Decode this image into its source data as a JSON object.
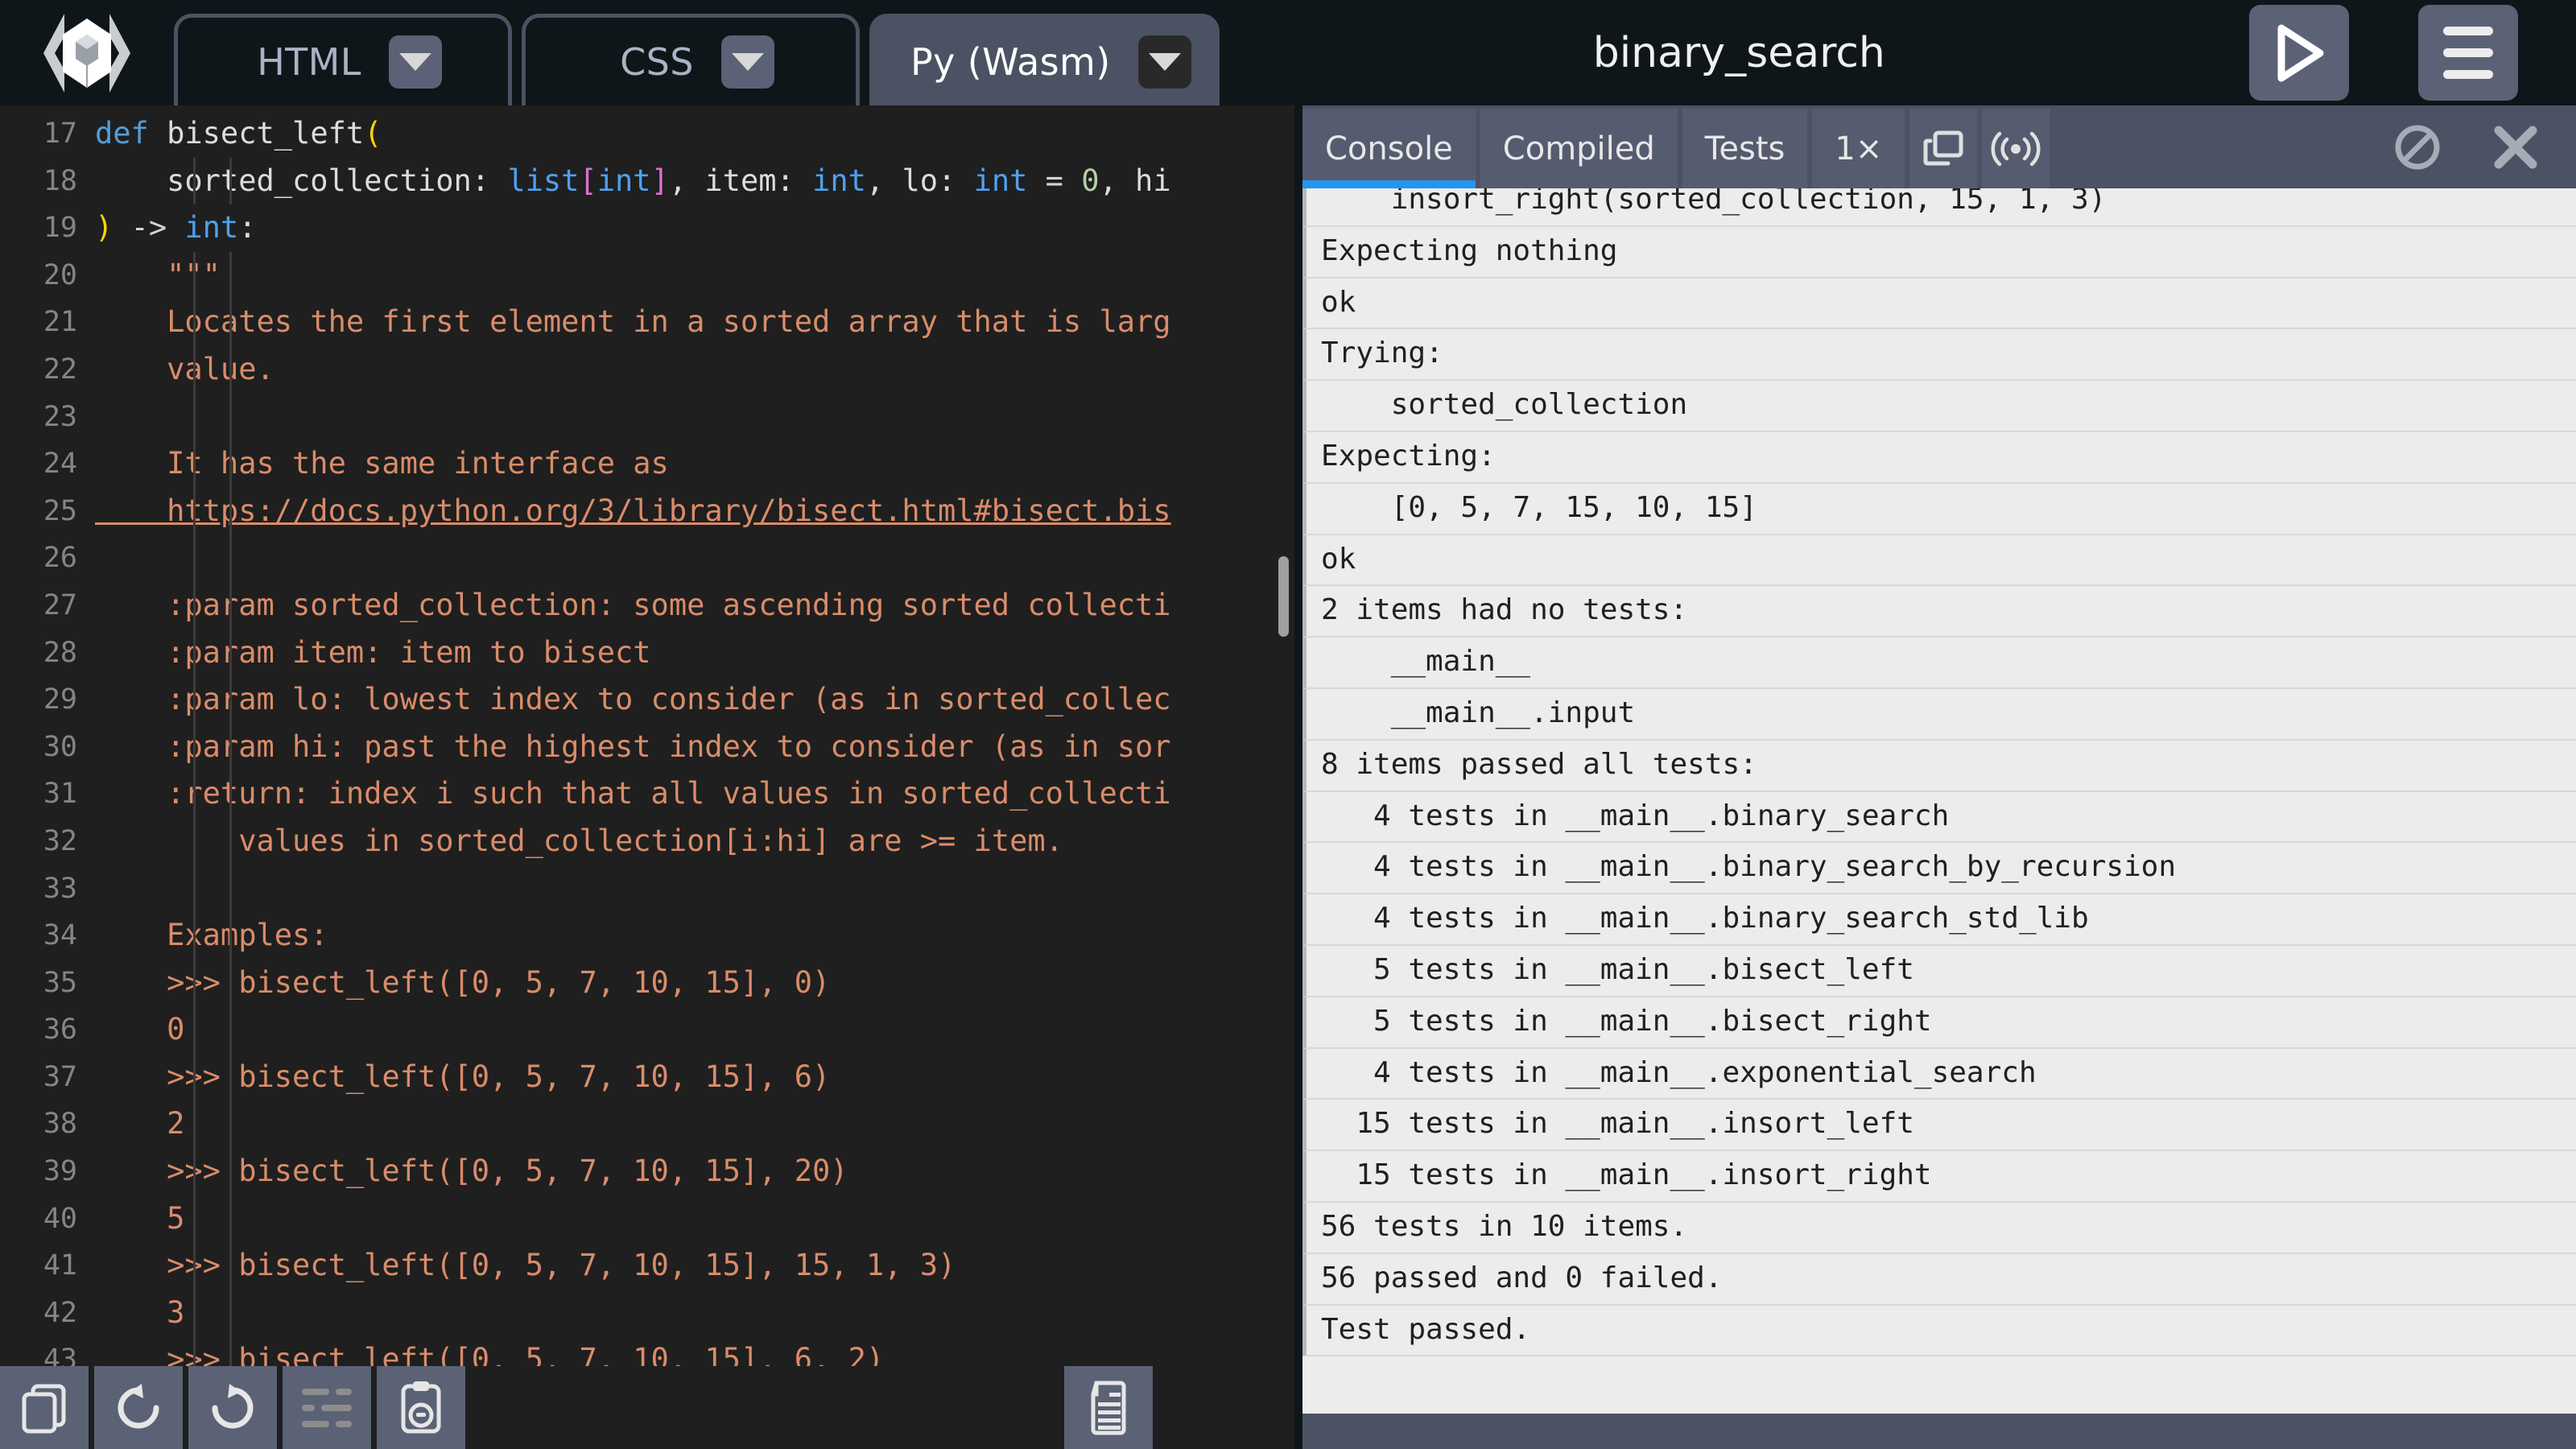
{
  "app": {
    "logo_icon": "code-cube-logo-icon",
    "document_title": "binary_search",
    "run_icon": "play-icon",
    "menu_icon": "hamburger-menu-icon"
  },
  "editor_tabs": [
    {
      "label": "HTML",
      "active": false,
      "caret_icon": "chevron-down-icon"
    },
    {
      "label": "CSS",
      "active": false,
      "caret_icon": "chevron-down-icon"
    },
    {
      "label": "Py (Wasm)",
      "active": true,
      "caret_icon": "chevron-down-icon"
    }
  ],
  "editor": {
    "first_line_number": 17,
    "lines": [
      {
        "n": 17,
        "indent": 0,
        "parts": [
          {
            "t": "def ",
            "c": "k"
          },
          {
            "t": "bisect_left",
            "c": "fn"
          },
          {
            "t": "(",
            "c": "par"
          }
        ]
      },
      {
        "n": 18,
        "indent": 2,
        "parts": [
          {
            "t": "    sorted_collection: ",
            "c": "fn"
          },
          {
            "t": "list",
            "c": "typ"
          },
          {
            "t": "[",
            "c": "brk"
          },
          {
            "t": "int",
            "c": "typ"
          },
          {
            "t": "]",
            "c": "brk"
          },
          {
            "t": ", item: ",
            "c": "fn"
          },
          {
            "t": "int",
            "c": "typ"
          },
          {
            "t": ", lo: ",
            "c": "fn"
          },
          {
            "t": "int",
            "c": "typ"
          },
          {
            "t": " = ",
            "c": "op"
          },
          {
            "t": "0",
            "c": "num"
          },
          {
            "t": ", hi",
            "c": "fn"
          }
        ]
      },
      {
        "n": 19,
        "indent": 0,
        "parts": [
          {
            "t": ")",
            "c": "par"
          },
          {
            "t": " -> ",
            "c": "op"
          },
          {
            "t": "int",
            "c": "typ"
          },
          {
            "t": ":",
            "c": "fn"
          }
        ]
      },
      {
        "n": 20,
        "indent": 2,
        "parts": [
          {
            "t": "    \"\"\"",
            "c": "str"
          }
        ]
      },
      {
        "n": 21,
        "indent": 2,
        "parts": [
          {
            "t": "    Locates the first element in a sorted array that is larg",
            "c": "str"
          }
        ]
      },
      {
        "n": 22,
        "indent": 2,
        "parts": [
          {
            "t": "    value.",
            "c": "str"
          }
        ]
      },
      {
        "n": 23,
        "indent": 2,
        "parts": []
      },
      {
        "n": 24,
        "indent": 2,
        "parts": [
          {
            "t": "    It has the same interface as",
            "c": "str"
          }
        ]
      },
      {
        "n": 25,
        "indent": 2,
        "parts": [
          {
            "t": "    https://docs.python.org/3/library/bisect.html#bisect.bis",
            "c": "lnk"
          }
        ]
      },
      {
        "n": 26,
        "indent": 2,
        "parts": []
      },
      {
        "n": 27,
        "indent": 2,
        "parts": [
          {
            "t": "    :param sorted_collection: some ascending sorted collecti",
            "c": "str"
          }
        ]
      },
      {
        "n": 28,
        "indent": 2,
        "parts": [
          {
            "t": "    :param item: item to bisect",
            "c": "str"
          }
        ]
      },
      {
        "n": 29,
        "indent": 2,
        "parts": [
          {
            "t": "    :param lo: lowest index to consider (as in sorted_collec",
            "c": "str"
          }
        ]
      },
      {
        "n": 30,
        "indent": 2,
        "parts": [
          {
            "t": "    :param hi: past the highest index to consider (as in sor",
            "c": "str"
          }
        ]
      },
      {
        "n": 31,
        "indent": 2,
        "parts": [
          {
            "t": "    :return: index i such that all values in sorted_collecti",
            "c": "str"
          }
        ]
      },
      {
        "n": 32,
        "indent": 3,
        "parts": [
          {
            "t": "        values in sorted_collection[i:hi] are >= item.",
            "c": "str"
          }
        ]
      },
      {
        "n": 33,
        "indent": 2,
        "parts": []
      },
      {
        "n": 34,
        "indent": 2,
        "parts": [
          {
            "t": "    Examples:",
            "c": "str"
          }
        ]
      },
      {
        "n": 35,
        "indent": 2,
        "parts": [
          {
            "t": "    >>> bisect_left([0, 5, 7, 10, 15], 0)",
            "c": "str"
          }
        ]
      },
      {
        "n": 36,
        "indent": 2,
        "parts": [
          {
            "t": "    0",
            "c": "str"
          }
        ]
      },
      {
        "n": 37,
        "indent": 2,
        "parts": [
          {
            "t": "    >>> bisect_left([0, 5, 7, 10, 15], 6)",
            "c": "str"
          }
        ]
      },
      {
        "n": 38,
        "indent": 2,
        "parts": [
          {
            "t": "    2",
            "c": "str"
          }
        ]
      },
      {
        "n": 39,
        "indent": 2,
        "parts": [
          {
            "t": "    >>> bisect_left([0, 5, 7, 10, 15], 20)",
            "c": "str"
          }
        ]
      },
      {
        "n": 40,
        "indent": 2,
        "parts": [
          {
            "t": "    5",
            "c": "str"
          }
        ]
      },
      {
        "n": 41,
        "indent": 2,
        "parts": [
          {
            "t": "    >>> bisect_left([0, 5, 7, 10, 15], 15, 1, 3)",
            "c": "str"
          }
        ]
      },
      {
        "n": 42,
        "indent": 2,
        "parts": [
          {
            "t": "    3",
            "c": "str"
          }
        ]
      },
      {
        "n": 43,
        "indent": 2,
        "parts": [
          {
            "t": "    >>> bisect_left([0, 5, 7, 10, 15], 6, 2)",
            "c": "str"
          }
        ]
      }
    ]
  },
  "editor_toolbar": {
    "buttons": [
      {
        "icon": "duplicate-icon"
      },
      {
        "icon": "undo-icon"
      },
      {
        "icon": "redo-icon"
      },
      {
        "icon": "format-lines-icon"
      },
      {
        "icon": "paste-link-icon"
      }
    ],
    "right_button": {
      "icon": "document-icon"
    }
  },
  "console": {
    "tabs": [
      {
        "label": "Console",
        "active": true
      },
      {
        "label": "Compiled",
        "active": false
      },
      {
        "label": "Tests",
        "active": false
      },
      {
        "label": "1×",
        "active": false
      }
    ],
    "icon_buttons": [
      {
        "icon": "copy-window-icon"
      },
      {
        "icon": "broadcast-icon"
      }
    ],
    "right_icons": [
      {
        "icon": "clear-console-icon"
      },
      {
        "icon": "close-icon"
      }
    ],
    "output_lines": [
      {
        "text": "    insort_right(sorted_collection, 15, 1, 3)",
        "clipped_top": false
      },
      {
        "text": "Expecting nothing"
      },
      {
        "text": "ok"
      },
      {
        "text": "Trying:"
      },
      {
        "text": "    sorted_collection"
      },
      {
        "text": "Expecting:"
      },
      {
        "text": "    [0, 5, 7, 15, 10, 15]"
      },
      {
        "text": "ok"
      },
      {
        "text": "2 items had no tests:"
      },
      {
        "text": "    __main__"
      },
      {
        "text": "    __main__.input"
      },
      {
        "text": "8 items passed all tests:"
      },
      {
        "text": "   4 tests in __main__.binary_search"
      },
      {
        "text": "   4 tests in __main__.binary_search_by_recursion"
      },
      {
        "text": "   4 tests in __main__.binary_search_std_lib"
      },
      {
        "text": "   5 tests in __main__.bisect_left"
      },
      {
        "text": "   5 tests in __main__.bisect_right"
      },
      {
        "text": "   4 tests in __main__.exponential_search"
      },
      {
        "text": "  15 tests in __main__.insort_left"
      },
      {
        "text": "  15 tests in __main__.insort_right"
      },
      {
        "text": "56 tests in 10 items."
      },
      {
        "text": "56 passed and 0 failed."
      },
      {
        "text": "Test passed."
      }
    ]
  },
  "colors": {
    "app_bg": "#0f1619",
    "chrome": "#4b5263",
    "editor_bg": "#1f1f1f",
    "console_bg": "#ececec",
    "accent_blue": "#2196f3"
  }
}
